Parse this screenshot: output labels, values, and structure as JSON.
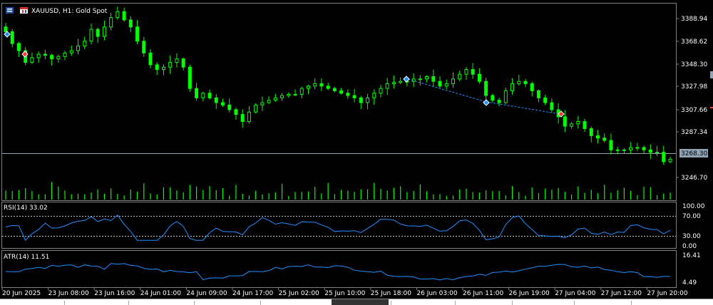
{
  "window": {
    "symbol_title": "XAUUSD, H1:  Gold Spot"
  },
  "price_panel": {
    "y_ticks": [
      "3388.94",
      "3368.62",
      "3348.30",
      "3327.98",
      "3307.66",
      "3287.34",
      "3246.70"
    ],
    "current_price_label": "3268.30"
  },
  "rsi_panel": {
    "title": "RSI(14) 33.02",
    "y_ticks": [
      "100.00",
      "70.00",
      "30.00",
      "0.00"
    ]
  },
  "atr_panel": {
    "title": "ATR(14) 11.51",
    "y_ticks": [
      "16.41",
      "4.49"
    ]
  },
  "time_axis": {
    "labels": [
      "20 Jun 2025",
      "23 Jun 08:00",
      "23 Jun 16:00",
      "24 Jun 01:00",
      "24 Jun 09:00",
      "24 Jun 17:00",
      "25 Jun 02:00",
      "25 Jun 10:00",
      "25 Jun 18:00",
      "26 Jun 03:00",
      "26 Jun 11:00",
      "26 Jun 19:00",
      "27 Jun 04:00",
      "27 Jun 12:00",
      "27 Jun 20:00"
    ]
  },
  "colors": {
    "background": "#000000",
    "candle": "#00ff00",
    "volume": "#00ff00",
    "indicator_line": "#1e90ff",
    "grid_text": "#ffffff",
    "trade_line": "#1e90ff"
  },
  "icons": [
    "chart-icon",
    "calendar-icon",
    "buy-arrow-icon",
    "sell-arrow-icon"
  ],
  "chart_data": {
    "type": "candlestick",
    "symbol": "XAUUSD",
    "timeframe": "H1",
    "price_range": [
      3236,
      3400
    ],
    "closes": [
      3378,
      3368,
      3362,
      3352,
      3356,
      3359,
      3358,
      3355,
      3357,
      3360,
      3362,
      3366,
      3370,
      3380,
      3374,
      3382,
      3390,
      3395,
      3388,
      3382,
      3370,
      3360,
      3350,
      3346,
      3348,
      3352,
      3355,
      3348,
      3330,
      3322,
      3326,
      3322,
      3318,
      3316,
      3312,
      3308,
      3302,
      3310,
      3316,
      3318,
      3320,
      3322,
      3324,
      3325,
      3325,
      3330,
      3332,
      3334,
      3332,
      3330,
      3328,
      3326,
      3324,
      3322,
      3318,
      3322,
      3326,
      3330,
      3334,
      3335,
      3336,
      3336,
      3338,
      3338,
      3340,
      3336,
      3332,
      3334,
      3338,
      3342,
      3346,
      3342,
      3336,
      3324,
      3320,
      3318,
      3328,
      3334,
      3336,
      3334,
      3328,
      3322,
      3318,
      3312,
      3306,
      3298,
      3300,
      3302,
      3296,
      3290,
      3288,
      3286,
      3278,
      3278,
      3278,
      3280,
      3280,
      3278,
      3276,
      3276,
      3268,
      3270
    ],
    "rsi_last": 33.02,
    "atr_last": 11.51
  }
}
